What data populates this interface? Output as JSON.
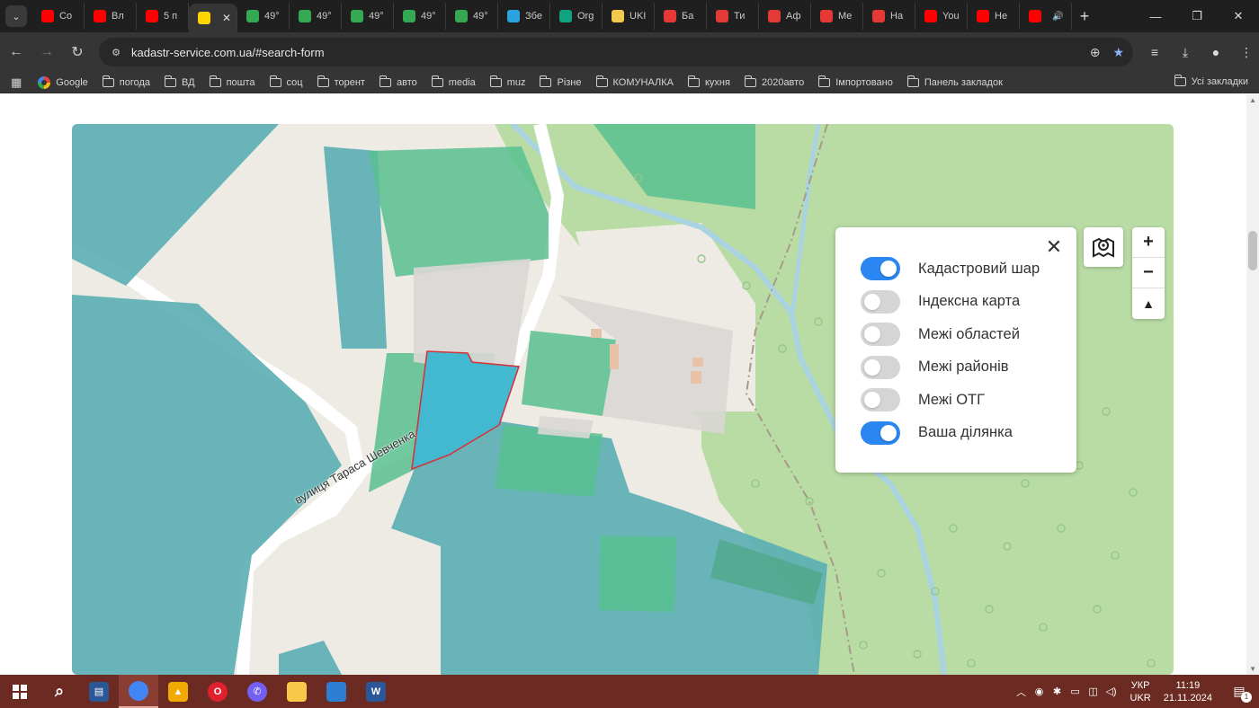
{
  "tabs": [
    {
      "label": "Co",
      "favicon": "youtube-icon",
      "color": "#ff0000"
    },
    {
      "label": "Вл",
      "favicon": "youtube-icon",
      "color": "#ff0000"
    },
    {
      "label": "5 п",
      "favicon": "youtube-icon",
      "color": "#ff0000"
    },
    {
      "label": "",
      "favicon": "ukraine-flag-icon",
      "color": "#ffd500",
      "active": true
    },
    {
      "label": "49°",
      "favicon": "maps-pin-icon",
      "color": "#34a853"
    },
    {
      "label": "49°",
      "favicon": "maps-pin-icon",
      "color": "#34a853"
    },
    {
      "label": "49°",
      "favicon": "maps-pin-icon",
      "color": "#34a853"
    },
    {
      "label": "49°",
      "favicon": "maps-pin-icon",
      "color": "#34a853"
    },
    {
      "label": "49°",
      "favicon": "maps-pin-icon",
      "color": "#34a853"
    },
    {
      "label": "Збе",
      "favicon": "telegram-icon",
      "color": "#2aa3e0"
    },
    {
      "label": "Org",
      "favicon": "openai-icon",
      "color": "#10a37f"
    },
    {
      "label": "UKI",
      "favicon": "bookmark-icon",
      "color": "#f2c94c"
    },
    {
      "label": "Бa",
      "favicon": "ua-site-icon",
      "color": "#e53935"
    },
    {
      "label": "Ти",
      "favicon": "fire-icon",
      "color": "#e53935"
    },
    {
      "label": "Аф",
      "favicon": "thumb-icon",
      "color": "#e53935"
    },
    {
      "label": "Ме",
      "favicon": "thumb-icon",
      "color": "#e53935"
    },
    {
      "label": "На",
      "favicon": "thumb-icon",
      "color": "#e53935"
    },
    {
      "label": "You",
      "favicon": "youtube-icon",
      "color": "#ff0000"
    },
    {
      "label": "Не",
      "favicon": "youtube-icon",
      "color": "#ff0000"
    },
    {
      "label": "",
      "favicon": "youtube-icon",
      "color": "#ff0000",
      "audio": true
    }
  ],
  "tab_close_symbol": "✕",
  "new_tab_symbol": "+",
  "window": {
    "minimize": "—",
    "maximize": "❐",
    "close": "✕"
  },
  "toolbar": {
    "back": "←",
    "forward": "→",
    "reload": "↻",
    "url": "kadastr-service.com.ua/#search-form"
  },
  "bookmarks": {
    "items": [
      {
        "label": "Google",
        "type": "google"
      },
      {
        "label": "погода",
        "type": "folder"
      },
      {
        "label": "ВД",
        "type": "folder"
      },
      {
        "label": "пошта",
        "type": "folder"
      },
      {
        "label": "соц",
        "type": "folder"
      },
      {
        "label": "торент",
        "type": "folder"
      },
      {
        "label": "авто",
        "type": "folder"
      },
      {
        "label": "media",
        "type": "folder"
      },
      {
        "label": "muz",
        "type": "folder"
      },
      {
        "label": "Різне",
        "type": "folder"
      },
      {
        "label": "КОМУНАЛКА",
        "type": "folder"
      },
      {
        "label": "кухня",
        "type": "folder"
      },
      {
        "label": "2020авто",
        "type": "folder"
      },
      {
        "label": "Імпортовано",
        "type": "folder"
      },
      {
        "label": "Панель закладок",
        "type": "folder"
      }
    ],
    "all_bookmarks": "Усі закладки"
  },
  "map": {
    "street_label": "вулиця Тараса Шевченка",
    "layers": [
      {
        "label": "Кадастровий шар",
        "on": true
      },
      {
        "label": "Індексна карта",
        "on": false
      },
      {
        "label": "Межі областей",
        "on": false
      },
      {
        "label": "Межі районів",
        "on": false
      },
      {
        "label": "Межі ОТГ",
        "on": false
      },
      {
        "label": "Ваша ділянка",
        "on": true
      }
    ],
    "close_symbol": "✕",
    "zoom_in": "+",
    "zoom_out": "−",
    "compass": "▲",
    "colors": {
      "parcel_teal": "#5aaeb4",
      "parcel_green": "#58c08f",
      "forest": "#b9dca5",
      "selected_parcel": "#43b9d1",
      "selected_outline": "#d6343d",
      "toggle_on": "#2a86f0"
    }
  },
  "taskbar": {
    "apps": [
      {
        "name": "search-icon",
        "label": "⌕"
      },
      {
        "name": "network-app-icon",
        "label": "▤"
      },
      {
        "name": "chrome-icon",
        "label": ""
      },
      {
        "name": "norton-icon",
        "label": "▲"
      },
      {
        "name": "opera-icon",
        "label": "O"
      },
      {
        "name": "viber-icon",
        "label": "✆"
      },
      {
        "name": "file-explorer-icon",
        "label": ""
      },
      {
        "name": "photos-icon",
        "label": ""
      },
      {
        "name": "word-icon",
        "label": "W"
      }
    ],
    "tray": {
      "lang_top": "УКР",
      "lang_bottom": "UKR",
      "time": "11:19",
      "date": "21.11.2024",
      "notifications": "1"
    }
  }
}
